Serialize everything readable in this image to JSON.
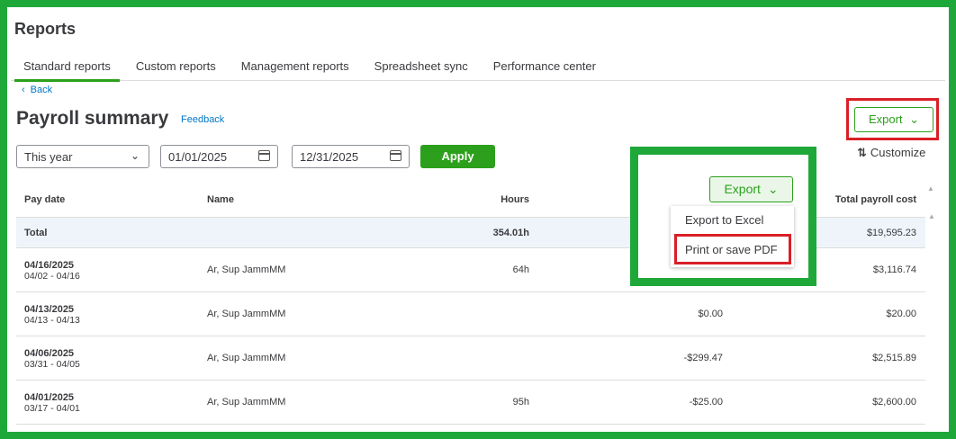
{
  "page": {
    "title": "Reports"
  },
  "tabs": [
    {
      "label": "Standard reports",
      "active": true
    },
    {
      "label": "Custom reports"
    },
    {
      "label": "Management reports"
    },
    {
      "label": "Spreadsheet sync"
    },
    {
      "label": "Performance center"
    }
  ],
  "back_label": "Back",
  "report": {
    "title": "Payroll summary",
    "feedback": "Feedback"
  },
  "filters": {
    "period": "This year",
    "start_date": "01/01/2025",
    "end_date": "12/31/2025",
    "apply_label": "Apply"
  },
  "export_top_label": "Export",
  "customize_label": "Customize",
  "export_menu": {
    "button_label": "Export",
    "items": [
      "Export to Excel",
      "Print or save PDF"
    ]
  },
  "table": {
    "columns": [
      "Pay date",
      "Name",
      "Hours",
      "Total payroll cost"
    ],
    "total": {
      "label": "Total",
      "hours": "354.01h",
      "total_cost": "$19,595.23"
    },
    "rows": [
      {
        "date": "04/16/2025",
        "period": "04/02 - 04/16",
        "name": "Ar, Sup JammMM",
        "hours": "64h",
        "net": "",
        "total_cost": "$3,116.74"
      },
      {
        "date": "04/13/2025",
        "period": "04/13 - 04/13",
        "name": "Ar, Sup JammMM",
        "hours": "",
        "net": "$0.00",
        "total_cost": "$20.00"
      },
      {
        "date": "04/06/2025",
        "period": "03/31 - 04/05",
        "name": "Ar, Sup JammMM",
        "hours": "",
        "net": "-$299.47",
        "total_cost": "$2,515.89"
      },
      {
        "date": "04/01/2025",
        "period": "03/17 - 04/01",
        "name": "Ar, Sup JammMM",
        "hours": "95h",
        "net": "-$25.00",
        "total_cost": "$2,600.00"
      }
    ]
  },
  "colors": {
    "brand_green": "#2ca01c",
    "highlight_green": "#1fa83a",
    "highlight_red": "#d91f26",
    "link_blue": "#0077c5"
  }
}
